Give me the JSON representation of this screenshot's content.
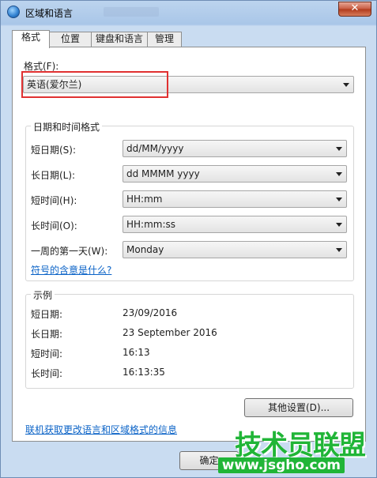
{
  "window": {
    "title": "区域和语言",
    "close_glyph": "✕"
  },
  "tabs": [
    {
      "label": "格式",
      "active": true
    },
    {
      "label": "位置",
      "active": false
    },
    {
      "label": "键盘和语言",
      "active": false
    },
    {
      "label": "管理",
      "active": false
    }
  ],
  "format": {
    "label": "格式(F):",
    "value": "英语(爱尔兰)"
  },
  "datetime_group": {
    "title": "日期和时间格式",
    "rows": [
      {
        "label": "短日期(S):",
        "value": "dd/MM/yyyy"
      },
      {
        "label": "长日期(L):",
        "value": "dd MMMM yyyy"
      },
      {
        "label": "短时间(H):",
        "value": "HH:mm"
      },
      {
        "label": "长时间(O):",
        "value": "HH:mm:ss"
      },
      {
        "label": "一周的第一天(W):",
        "value": "Monday"
      }
    ],
    "help_link": "符号的含意是什么?"
  },
  "example_group": {
    "title": "示例",
    "rows": [
      {
        "label": "短日期:",
        "value": "23/09/2016"
      },
      {
        "label": "长日期:",
        "value": "23 September 2016"
      },
      {
        "label": "短时间:",
        "value": "16:13"
      },
      {
        "label": "长时间:",
        "value": "16:13:35"
      }
    ]
  },
  "other_settings_button": "其他设置(D)...",
  "online_link": "联机获取更改语言和区域格式的信息",
  "ok_button": "确定",
  "watermark": {
    "brand": "技术员联盟",
    "url": "www.jsgho.com"
  },
  "colors": {
    "highlight_border": "#e03131",
    "link": "#0b63c7",
    "watermark": "#20b537"
  }
}
